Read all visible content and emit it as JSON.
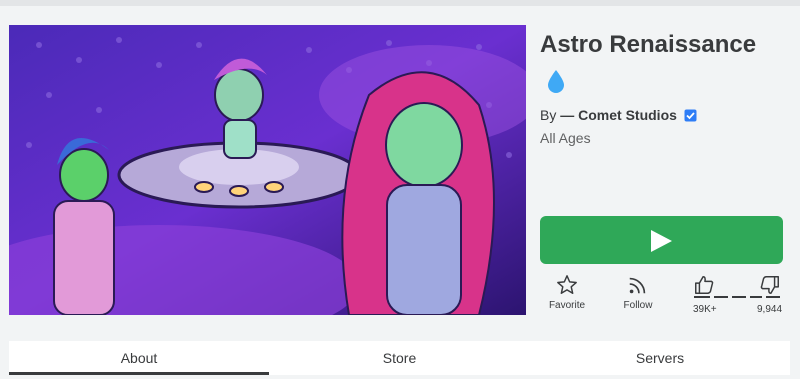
{
  "game": {
    "title": "Astro Renaissance",
    "creator_prefix": "By",
    "creator_name": "— Comet Studios",
    "age_rating": "All Ages"
  },
  "icons": {
    "drop": "water-drop-icon",
    "verified": "verified-badge-icon",
    "play": "play-icon",
    "favorite": "star-icon",
    "follow": "rss-icon",
    "like": "thumbs-up-icon",
    "dislike": "thumbs-down-icon"
  },
  "actions": {
    "favorite_label": "Favorite",
    "follow_label": "Follow"
  },
  "votes": {
    "likes": "39K+",
    "dislikes": "9,944"
  },
  "tabs": [
    {
      "label": "About",
      "active": true
    },
    {
      "label": "Store",
      "active": false
    },
    {
      "label": "Servers",
      "active": false
    }
  ],
  "colors": {
    "play_button": "#2fa858",
    "verified": "#2e7df6",
    "drop": "#3fa9f5",
    "background": "#f2f4f5"
  }
}
